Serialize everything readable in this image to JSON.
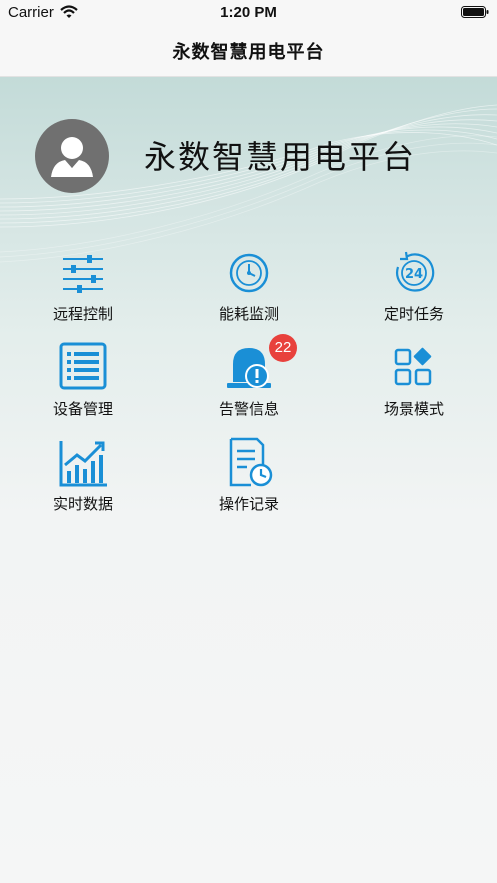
{
  "status_bar": {
    "carrier": "Carrier",
    "time": "1:20 PM"
  },
  "nav": {
    "title": "永数智慧用电平台"
  },
  "header": {
    "platform_name": "永数智慧用电平台"
  },
  "menu": {
    "remote_control": "远程控制",
    "energy_monitor": "能耗监测",
    "timer_task": "定时任务",
    "device_manage": "设备管理",
    "alarm_info": "告警信息",
    "alarm_badge": "22",
    "scene_mode": "场景模式",
    "realtime_data": "实时数据",
    "operation_log": "操作记录"
  },
  "colors": {
    "accent": "#1a8fd6",
    "badge": "#e8413c",
    "avatar": "#707070"
  }
}
